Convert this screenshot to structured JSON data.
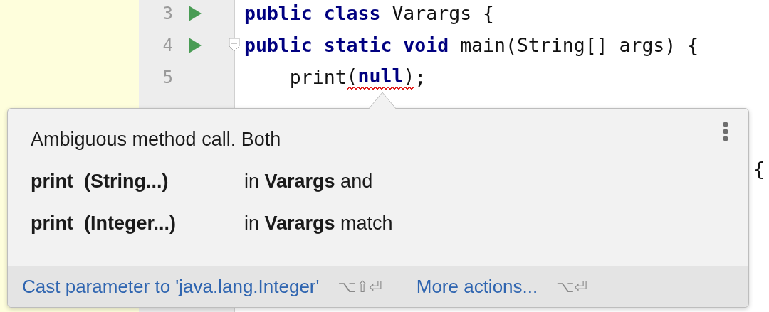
{
  "gutter": [
    {
      "number": "3",
      "run": true,
      "fold": false
    },
    {
      "number": "4",
      "run": true,
      "fold": true
    },
    {
      "number": "5",
      "run": false,
      "fold": false
    }
  ],
  "code": [
    [
      {
        "text": "public class",
        "kind": "keyword",
        "error": false
      },
      {
        "text": " Varargs {",
        "kind": "plain",
        "error": false
      }
    ],
    [
      {
        "text": "public static void",
        "kind": "keyword",
        "error": false
      },
      {
        "text": " main(String[] args) {",
        "kind": "plain",
        "error": false
      }
    ],
    [
      {
        "text": "    print",
        "kind": "plain",
        "error": false
      },
      {
        "text": "(**null**)",
        "kind": "plain",
        "error": true
      },
      {
        "text": ";",
        "kind": "plain",
        "error": false
      }
    ]
  ],
  "hidden_code_fragment": "{",
  "popup": {
    "message": "Ambiguous method call. Both",
    "candidates": [
      {
        "signature": "print  (String...)",
        "text": "in **Varargs** and"
      },
      {
        "signature": "print  (Integer...)",
        "text": "in **Varargs** match"
      }
    ],
    "actions": [
      {
        "label": "Cast parameter to 'java.lang.Integer'",
        "shortcut": "⌥⇧⏎"
      },
      {
        "label": "More actions...",
        "shortcut": "⌥⏎"
      }
    ]
  }
}
